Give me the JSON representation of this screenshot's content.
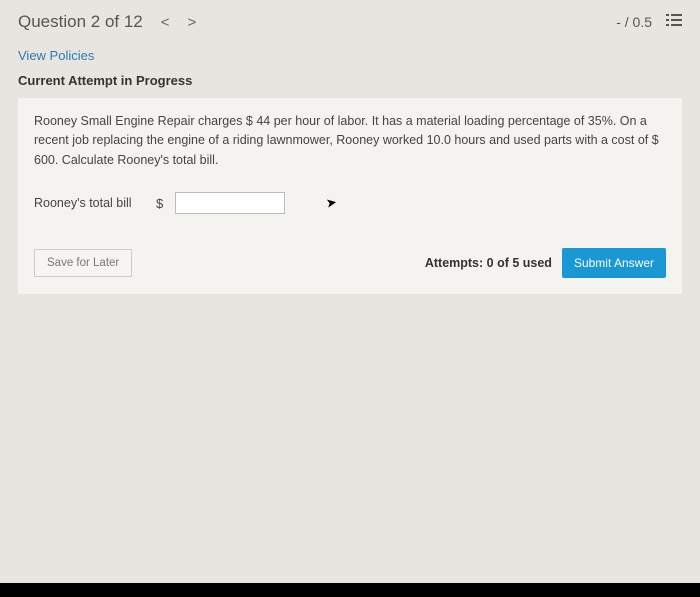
{
  "header": {
    "title": "Question 2 of 12",
    "nav_prev": "<",
    "nav_next": ">",
    "score": "- / 0.5"
  },
  "policies_link": "View Policies",
  "attempt_status": "Current Attempt in Progress",
  "problem_text": "Rooney Small Engine Repair charges $ 44 per hour of labor. It has a material loading percentage of 35%. On a recent job replacing the engine of a riding lawnmower, Rooney worked 10.0 hours and used parts with a cost of $ 600. Calculate Rooney's total bill.",
  "input": {
    "label": "Rooney's total bill",
    "currency": "$",
    "value": ""
  },
  "footer": {
    "save_label": "Save for Later",
    "attempts_text": "Attempts: 0 of 5 used",
    "submit_label": "Submit Answer"
  }
}
